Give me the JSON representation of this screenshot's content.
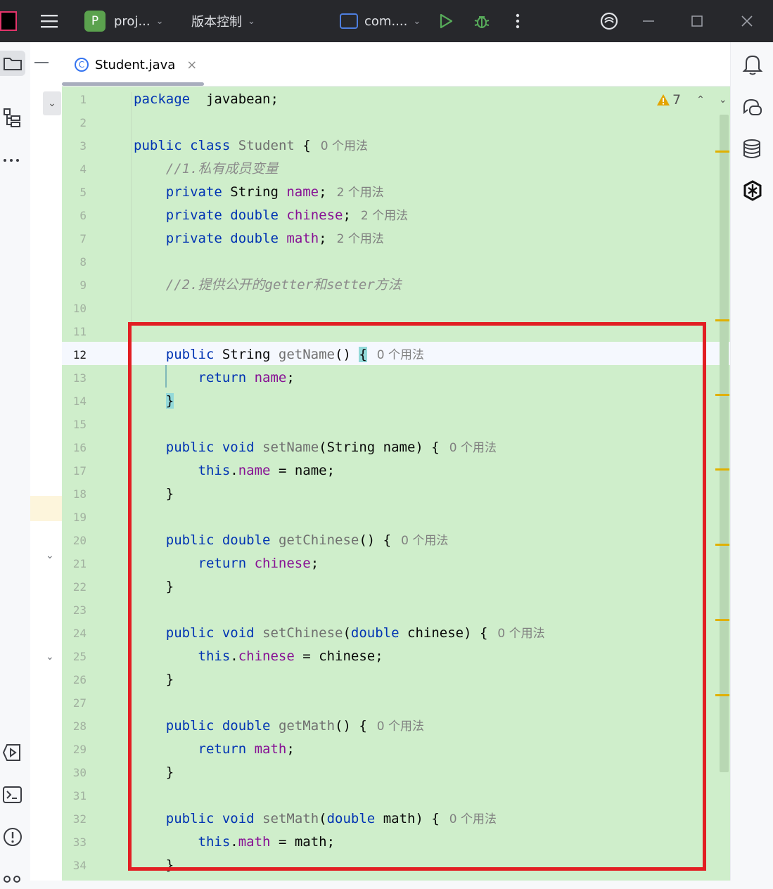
{
  "titlebar": {
    "project_initial": "P",
    "project_name": "proj...",
    "vcs_label": "版本控制",
    "run_config": "com...."
  },
  "tab": {
    "file_name": "Student.java",
    "icon_letter": "C"
  },
  "inspections": {
    "warning_count": "7"
  },
  "editor": {
    "current_line": 12,
    "lines": [
      {
        "n": "1",
        "segs": [
          [
            "kw",
            "package"
          ],
          [
            "",
            "  javabean;"
          ]
        ]
      },
      {
        "n": "2",
        "segs": []
      },
      {
        "n": "3",
        "segs": [
          [
            "kw",
            "public"
          ],
          [
            "",
            " "
          ],
          [
            "kw",
            "class"
          ],
          [
            "",
            " "
          ],
          [
            "mth",
            "Student"
          ],
          [
            "",
            " {"
          ],
          [
            "hint",
            "0 个用法"
          ]
        ]
      },
      {
        "n": "4",
        "segs": [
          [
            "",
            "    "
          ],
          [
            "cmt",
            "//1.私有成员变量"
          ]
        ]
      },
      {
        "n": "5",
        "segs": [
          [
            "",
            "    "
          ],
          [
            "kw",
            "private"
          ],
          [
            "",
            " String "
          ],
          [
            "fld",
            "name"
          ],
          [
            "",
            ";"
          ],
          [
            "hint",
            "2 个用法"
          ]
        ]
      },
      {
        "n": "6",
        "segs": [
          [
            "",
            "    "
          ],
          [
            "kw",
            "private"
          ],
          [
            "",
            " "
          ],
          [
            "kw",
            "double"
          ],
          [
            "",
            " "
          ],
          [
            "fld",
            "chinese"
          ],
          [
            "",
            ";"
          ],
          [
            "hint",
            "2 个用法"
          ]
        ]
      },
      {
        "n": "7",
        "segs": [
          [
            "",
            "    "
          ],
          [
            "kw",
            "private"
          ],
          [
            "",
            " "
          ],
          [
            "kw",
            "double"
          ],
          [
            "",
            " "
          ],
          [
            "fld",
            "math"
          ],
          [
            "",
            ";"
          ],
          [
            "hint",
            "2 个用法"
          ]
        ]
      },
      {
        "n": "8",
        "segs": []
      },
      {
        "n": "9",
        "segs": [
          [
            "",
            "    "
          ],
          [
            "cmt",
            "//2.提供公开的getter和setter方法"
          ]
        ]
      },
      {
        "n": "10",
        "segs": []
      },
      {
        "n": "11",
        "segs": []
      },
      {
        "n": "12",
        "segs": [
          [
            "",
            "    "
          ],
          [
            "kw",
            "public"
          ],
          [
            "",
            " String "
          ],
          [
            "mth",
            "getName"
          ],
          [
            "",
            "() "
          ],
          [
            "br",
            "{"
          ],
          [
            "hint",
            "0 个用法"
          ]
        ]
      },
      {
        "n": "13",
        "segs": [
          [
            "",
            "        "
          ],
          [
            "kw",
            "return"
          ],
          [
            "",
            " "
          ],
          [
            "fld",
            "name"
          ],
          [
            "",
            ";"
          ]
        ]
      },
      {
        "n": "14",
        "segs": [
          [
            "",
            "    "
          ],
          [
            "br",
            "}"
          ]
        ]
      },
      {
        "n": "15",
        "segs": []
      },
      {
        "n": "16",
        "segs": [
          [
            "",
            "    "
          ],
          [
            "kw",
            "public"
          ],
          [
            "",
            " "
          ],
          [
            "kw",
            "void"
          ],
          [
            "",
            " "
          ],
          [
            "mth",
            "setName"
          ],
          [
            "",
            "(String name) {"
          ],
          [
            "hint",
            "0 个用法"
          ]
        ]
      },
      {
        "n": "17",
        "segs": [
          [
            "",
            "        "
          ],
          [
            "kw",
            "this"
          ],
          [
            "",
            "."
          ],
          [
            "fld",
            "name"
          ],
          [
            "",
            " = name;"
          ]
        ]
      },
      {
        "n": "18",
        "segs": [
          [
            "",
            "    }"
          ]
        ]
      },
      {
        "n": "19",
        "segs": []
      },
      {
        "n": "20",
        "segs": [
          [
            "",
            "    "
          ],
          [
            "kw",
            "public"
          ],
          [
            "",
            " "
          ],
          [
            "kw",
            "double"
          ],
          [
            "",
            " "
          ],
          [
            "mth",
            "getChinese"
          ],
          [
            "",
            "() {"
          ],
          [
            "hint",
            "0 个用法"
          ]
        ]
      },
      {
        "n": "21",
        "segs": [
          [
            "",
            "        "
          ],
          [
            "kw",
            "return"
          ],
          [
            "",
            " "
          ],
          [
            "fld",
            "chinese"
          ],
          [
            "",
            ";"
          ]
        ]
      },
      {
        "n": "22",
        "segs": [
          [
            "",
            "    }"
          ]
        ]
      },
      {
        "n": "23",
        "segs": []
      },
      {
        "n": "24",
        "segs": [
          [
            "",
            "    "
          ],
          [
            "kw",
            "public"
          ],
          [
            "",
            " "
          ],
          [
            "kw",
            "void"
          ],
          [
            "",
            " "
          ],
          [
            "mth",
            "setChinese"
          ],
          [
            "",
            "("
          ],
          [
            "kw",
            "double"
          ],
          [
            "",
            " chinese) {"
          ],
          [
            "hint",
            "0 个用法"
          ]
        ]
      },
      {
        "n": "25",
        "segs": [
          [
            "",
            "        "
          ],
          [
            "kw",
            "this"
          ],
          [
            "",
            "."
          ],
          [
            "fld",
            "chinese"
          ],
          [
            "",
            " = chinese;"
          ]
        ]
      },
      {
        "n": "26",
        "segs": [
          [
            "",
            "    }"
          ]
        ]
      },
      {
        "n": "27",
        "segs": []
      },
      {
        "n": "28",
        "segs": [
          [
            "",
            "    "
          ],
          [
            "kw",
            "public"
          ],
          [
            "",
            " "
          ],
          [
            "kw",
            "double"
          ],
          [
            "",
            " "
          ],
          [
            "mth",
            "getMath"
          ],
          [
            "",
            "() {"
          ],
          [
            "hint",
            "0 个用法"
          ]
        ]
      },
      {
        "n": "29",
        "segs": [
          [
            "",
            "        "
          ],
          [
            "kw",
            "return"
          ],
          [
            "",
            " "
          ],
          [
            "fld",
            "math"
          ],
          [
            "",
            ";"
          ]
        ]
      },
      {
        "n": "30",
        "segs": [
          [
            "",
            "    }"
          ]
        ]
      },
      {
        "n": "31",
        "segs": []
      },
      {
        "n": "32",
        "segs": [
          [
            "",
            "    "
          ],
          [
            "kw",
            "public"
          ],
          [
            "",
            " "
          ],
          [
            "kw",
            "void"
          ],
          [
            "",
            " "
          ],
          [
            "mth",
            "setMath"
          ],
          [
            "",
            "("
          ],
          [
            "kw",
            "double"
          ],
          [
            "",
            " math) {"
          ],
          [
            "hint",
            "0 个用法"
          ]
        ]
      },
      {
        "n": "33",
        "segs": [
          [
            "",
            "        "
          ],
          [
            "kw",
            "this"
          ],
          [
            "",
            "."
          ],
          [
            "fld",
            "math"
          ],
          [
            "",
            " = math;"
          ]
        ]
      },
      {
        "n": "34",
        "segs": [
          [
            "",
            "    }"
          ]
        ]
      }
    ]
  },
  "colors": {
    "editor_bg": "#cfeecb",
    "keyword": "#0033b3",
    "field": "#871094",
    "annotation_box": "#e21e23"
  },
  "icons": {
    "left": [
      "folder-icon",
      "structure-icon",
      "more-icon",
      "services-icon",
      "terminal-icon",
      "problems-icon",
      "git-icon"
    ],
    "right": [
      "notifications-icon",
      "ai-chat-icon",
      "database-icon",
      "openai-icon"
    ]
  }
}
